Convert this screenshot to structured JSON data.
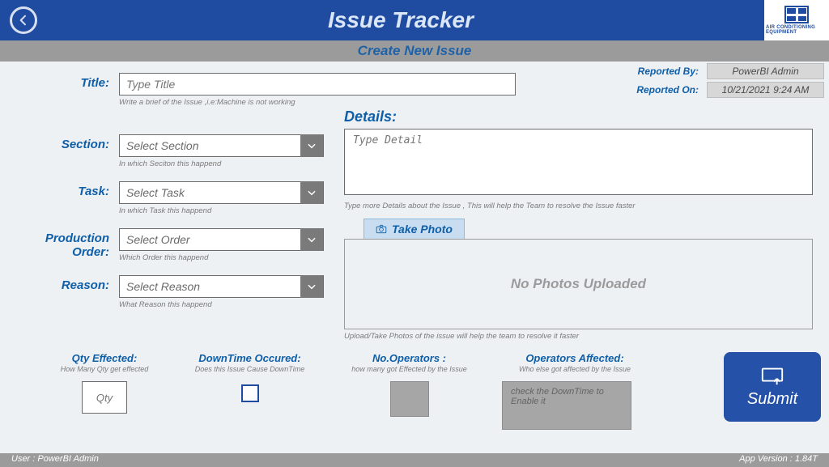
{
  "header": {
    "title": "Issue Tracker",
    "logo_text": "AIR CONDITIONING EQUIPMENT"
  },
  "subheader": "Create New Issue",
  "reported": {
    "by_label": "Reported By:",
    "by_value": "PowerBI Admin",
    "on_label": "Reported On:",
    "on_value": "10/21/2021 9:24 AM"
  },
  "fields": {
    "title": {
      "label": "Title:",
      "placeholder": "Type Title",
      "hint": "Write a brief of the Issue ,i.e:Machine is not working"
    },
    "section": {
      "label": "Section:",
      "placeholder": "Select Section",
      "hint": "In which Seciton this happend"
    },
    "task": {
      "label": "Task:",
      "placeholder": "Select Task",
      "hint": "In which Task this happend"
    },
    "order": {
      "label": "Production Order:",
      "placeholder": "Select Order",
      "hint": "Which Order this happend"
    },
    "reason": {
      "label": "Reason:",
      "placeholder": "Select Reason",
      "hint": "What Reason this happend"
    }
  },
  "details": {
    "label": "Details:",
    "placeholder": "Type Detail",
    "hint": "Type more Details about the Issue , This will help the Team to resolve the Issue faster"
  },
  "photos": {
    "take_label": "Take Photo",
    "empty": "No Photos Uploaded",
    "hint": "Upload/Take Photos of the issue will help the team to resolve it faster"
  },
  "bottom": {
    "qty": {
      "title": "Qty Effected:",
      "hint": "How Many Qty get effected",
      "placeholder": "Qty"
    },
    "downtime": {
      "title": "DownTime Occured:",
      "hint": "Does this Issue Cause DownTime"
    },
    "ops": {
      "title": "No.Operators :",
      "hint": "how many got Effected by the Issue"
    },
    "ops_aff": {
      "title": "Operators Affected:",
      "hint": "Who else got affected by the Issue",
      "placeholder": "check the DownTime to Enable it"
    }
  },
  "submit_label": "Submit",
  "footer": {
    "user_prefix": "User : ",
    "user": "PowerBI Admin",
    "version_prefix": "App Version : ",
    "version": "1.84T"
  }
}
